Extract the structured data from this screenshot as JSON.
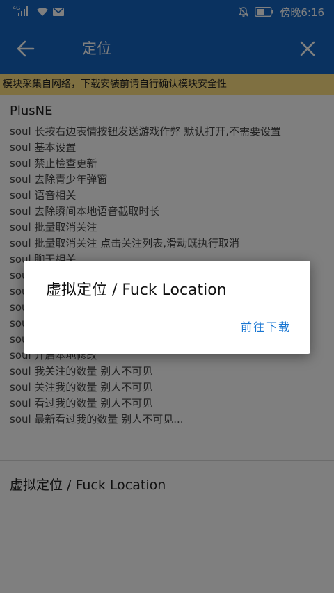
{
  "status_bar": {
    "network": "4G",
    "time": "傍晚6:16",
    "icons": [
      "signal-icon",
      "wifi-icon",
      "mail-icon",
      "mute-bell-icon",
      "battery-icon"
    ]
  },
  "app_bar": {
    "title": "定位",
    "back_icon": "arrow-left-icon",
    "close_icon": "close-icon",
    "color": "#1565c0"
  },
  "notice": {
    "text": "模块采集自网络，下载安装前请自行确认模块安全性",
    "color": "#ffe082"
  },
  "modules": [
    {
      "name": "PlusNE",
      "lines": [
        "soul 长按右边表情按钮发送游戏作弊 默认打开,不需要设置",
        "soul 基本设置",
        "soul 禁止检查更新",
        "soul 去除青少年弹窗",
        "soul 语音相关",
        "soul 去除瞬间本地语音截取时长",
        "soul 批量取消关注",
        "soul 批量取消关注 点击关注列表,滑动既执行取消",
        "soul 聊天相关",
        "soul",
        "soul",
        "soul",
        "soul",
        "soul 本地修改",
        "soul 开启本地修改",
        "soul 我关注的数量 别人不可见",
        "soul 关注我的数量 别人不可见",
        "soul 看过我的数量 别人不可见",
        "soul 最新看过我的数量 别人不可见..."
      ]
    },
    {
      "name": "虚拟定位 / Fuck Location",
      "lines": []
    }
  ],
  "dialog": {
    "title": "虚拟定位 / Fuck Location",
    "button": "前往下载",
    "button_color": "#1976d2"
  }
}
